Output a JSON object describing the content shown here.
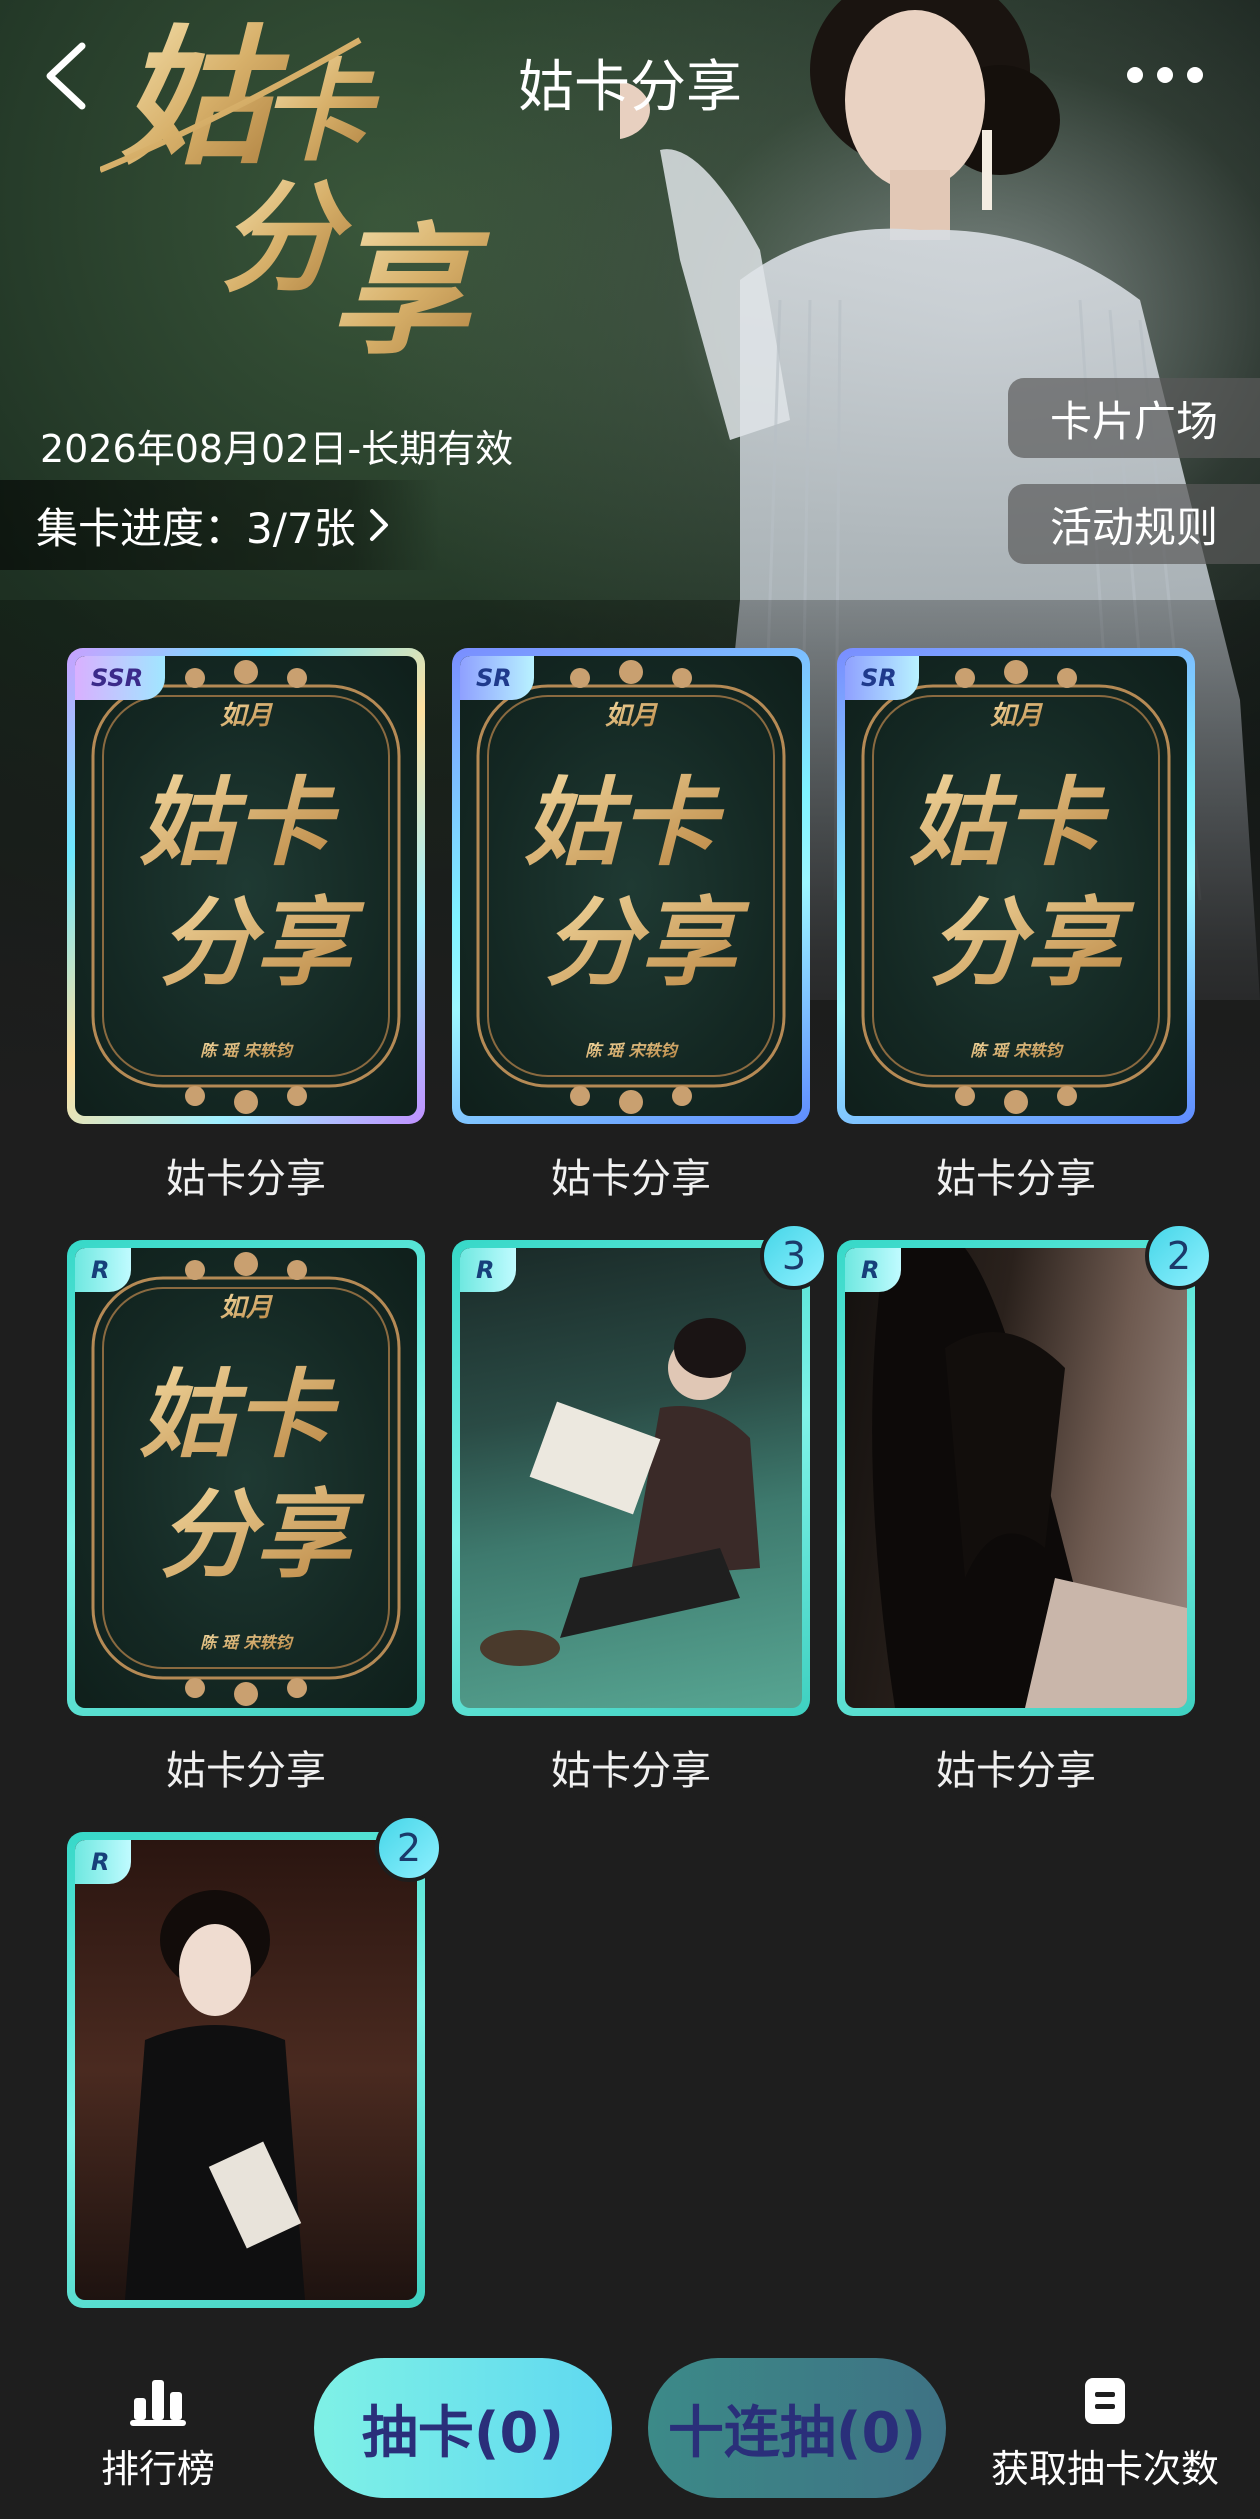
{
  "header": {
    "title": "姑卡分享",
    "back_icon": "chevron-left-icon",
    "more_icon": "more-dots-icon"
  },
  "banner": {
    "calligraphy_text": "姑卡分享",
    "date_text": "2026年08月02日-长期有效",
    "progress_label": "集卡进度：",
    "progress_value": "3/7张",
    "plaza_button": "卡片广场",
    "rules_button": "活动规则"
  },
  "cards": [
    {
      "name": "姑卡分享",
      "rarity": "SSR",
      "style": "poster",
      "count": ""
    },
    {
      "name": "姑卡分享",
      "rarity": "SR",
      "style": "poster",
      "count": ""
    },
    {
      "name": "姑卡分享",
      "rarity": "SR",
      "style": "poster",
      "count": ""
    },
    {
      "name": "姑卡分享",
      "rarity": "R",
      "style": "poster",
      "count": ""
    },
    {
      "name": "姑卡分享",
      "rarity": "R",
      "style": "photo1",
      "count": "3"
    },
    {
      "name": "姑卡分享",
      "rarity": "R",
      "style": "photo2",
      "count": "2"
    },
    {
      "name": "",
      "rarity": "R",
      "style": "photo3",
      "count": "2"
    }
  ],
  "poster_text": {
    "top": "如月",
    "main1": "姑卡",
    "main2": "分享",
    "bottom": "陈 瑶    宋轶钧"
  },
  "bottom_bar": {
    "rank_label": "排行榜",
    "draw_button": "抽卡(0)",
    "draw10_button": "十连抽(0)",
    "get_label": "获取抽卡次数",
    "rank_icon": "bar-chart-icon",
    "get_icon": "document-icon"
  },
  "colors": {
    "background": "#1e1e1e",
    "accent_teal": "#7ff1e6",
    "button_text": "#2a2f7a"
  }
}
